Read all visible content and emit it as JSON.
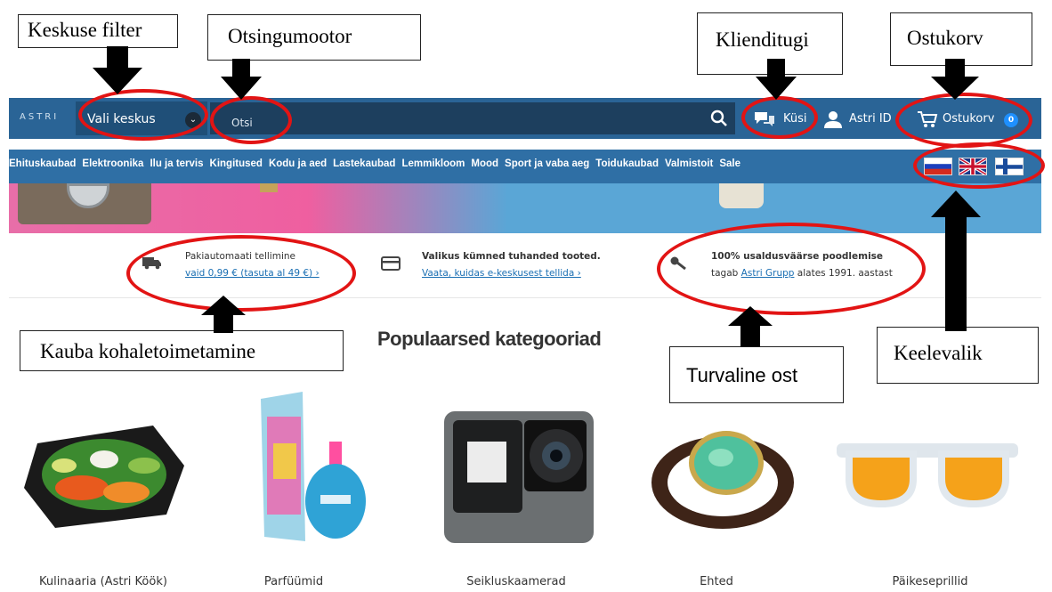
{
  "header": {
    "logo": "ASTRI",
    "center_filter": "Vali keskus",
    "search_placeholder": "Otsi",
    "ask": "Küsi",
    "account": "Astri ID",
    "cart": "Ostukorv",
    "cart_count": "0"
  },
  "categories": [
    "Ehituskaubad",
    "Elektroonika",
    "Ilu ja tervis",
    "Kingitused",
    "Kodu ja aed",
    "Lastekaubad",
    "Lemmikloom",
    "Mood",
    "Sport ja vaba aeg",
    "Toidukaubad",
    "Valmistoit",
    "Sale"
  ],
  "languages": [
    "Русский",
    "English",
    "Suomi"
  ],
  "info": {
    "delivery": {
      "text": "Pakiautomaati tellimine",
      "link": "vaid 0,99 € (tasuta al 49 €) ›"
    },
    "selection": {
      "text": "Valikus kümned tuhanded tooted.",
      "link": "Vaata, kuidas e-keskusest tellida ›"
    },
    "trust": {
      "text": "100% usaldusväärse poodlemise",
      "prefix": "tagab",
      "link": "Astri Grupp",
      "suffix": "alates 1991. aastast"
    }
  },
  "popular": {
    "title": "Populaarsed kategooriad",
    "items": [
      "Kulinaaria (Astri Köök)",
      "Parfüümid",
      "Seikluskaamerad",
      "Ehted",
      "Päikeseprillid"
    ]
  },
  "annotations": {
    "filter": "Keskuse filter",
    "search": "Otsingumootor",
    "support": "Klienditugi",
    "cart": "Ostukorv",
    "delivery": "Kauba kohaletoimetamine",
    "secure": "Turvaline ost",
    "language": "Keelevalik"
  },
  "colors": {
    "header": "#2a6496",
    "nav": "#2f6fa5",
    "annotation_red": "#e21414",
    "link": "#1a6fb3"
  }
}
